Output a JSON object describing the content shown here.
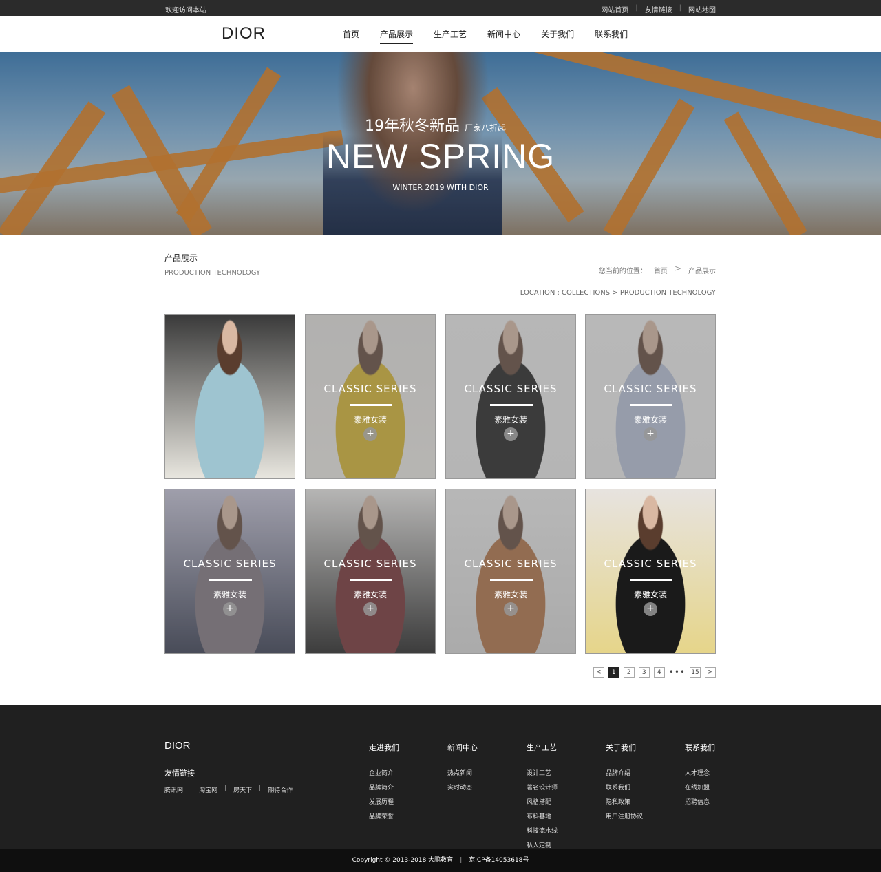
{
  "topbar": {
    "welcome": "欢迎访问本站",
    "links": [
      "网站首页",
      "友情链接",
      "网站地图"
    ]
  },
  "header": {
    "logo": "DIOR",
    "nav": [
      "首页",
      "产品展示",
      "生产工艺",
      "新闻中心",
      "关于我们",
      "联系我们"
    ],
    "active_nav": "产品展示"
  },
  "banner": {
    "line1": "19年秋冬新品",
    "line1_small": "厂家八折起",
    "headline": "NEW SPRING",
    "subline": "WINTER 2019  WITH DIOR"
  },
  "section": {
    "title_cn": "产品展示",
    "title_en": "PRODUCTION TECHNOLOGY",
    "crumb_label": "您当前的位置：",
    "crumb_home": "首页",
    "crumb_sep": ">",
    "crumb_current": "产品展示",
    "location": "LOCATION : COLLECTIONS  >  PRODUCTION TECHNOLOGY"
  },
  "products": [
    {
      "series": "",
      "sub": "",
      "overlay": false,
      "palette": [
        "#3a3a3a",
        "#9ec4d0",
        "#e8e6df"
      ]
    },
    {
      "series": "CLASSIC  SERIES",
      "sub": "素雅女装",
      "overlay": true,
      "palette": [
        "#e9e7e4",
        "#d9b422",
        "#f1efea"
      ]
    },
    {
      "series": "CLASSIC  SERIES",
      "sub": "素雅女装",
      "overlay": true,
      "palette": [
        "#f2f2f2",
        "#111111",
        "#efefef"
      ]
    },
    {
      "series": "CLASSIC  SERIES",
      "sub": "素雅女装",
      "overlay": true,
      "palette": [
        "#f4f4f4",
        "#b6c2db",
        "#f1f1f1"
      ]
    },
    {
      "series": "CLASSIC  SERIES",
      "sub": "素雅女装",
      "overlay": true,
      "palette": [
        "#c7c6dd",
        "#7a6f7a",
        "#2a3047"
      ]
    },
    {
      "series": "CLASSIC  SERIES",
      "sub": "素雅女装",
      "overlay": true,
      "palette": [
        "#f0efed",
        "#6e2226",
        "#141414"
      ]
    },
    {
      "series": "CLASSIC  SERIES",
      "sub": "素雅女装",
      "overlay": true,
      "palette": [
        "#f3f3f3",
        "#b06a3a",
        "#dcdcdc"
      ]
    },
    {
      "series": "CLASSIC  SERIES",
      "sub": "素雅女装",
      "overlay": false,
      "palette": [
        "#e7e3df",
        "#1a1a1a",
        "#e6d58a"
      ]
    }
  ],
  "plus_icon": "+",
  "pagination": {
    "prev": "<",
    "pages": [
      "1",
      "2",
      "3",
      "4"
    ],
    "dots": "•••",
    "last": "15",
    "next": ">",
    "current": "1"
  },
  "footer": {
    "logo": "DIOR",
    "friend_title": "友情链接",
    "friend_links": [
      "腾讯网",
      "淘宝网",
      "房天下",
      "期待合作"
    ],
    "columns": [
      {
        "title": "走进我们",
        "items": [
          "企业简介",
          "品牌简介",
          "发展历程",
          "品牌荣誉"
        ]
      },
      {
        "title": "新闻中心",
        "items": [
          "热点新闻",
          "实时动态"
        ]
      },
      {
        "title": "生产工艺",
        "items": [
          "设计工艺",
          "著名设计师",
          "风格搭配",
          "布料基地",
          "科技流水线",
          "私人定制"
        ]
      },
      {
        "title": "关于我们",
        "items": [
          "品牌介绍",
          "联系我们",
          "隐私政策",
          "用户注册协议"
        ]
      },
      {
        "title": "联系我们",
        "items": [
          "人才理念",
          "在线加盟",
          "招聘信息"
        ]
      }
    ],
    "copyright": "Copyright © 2013-2018 大鹏教育",
    "icp": "京ICP备14053618号"
  }
}
